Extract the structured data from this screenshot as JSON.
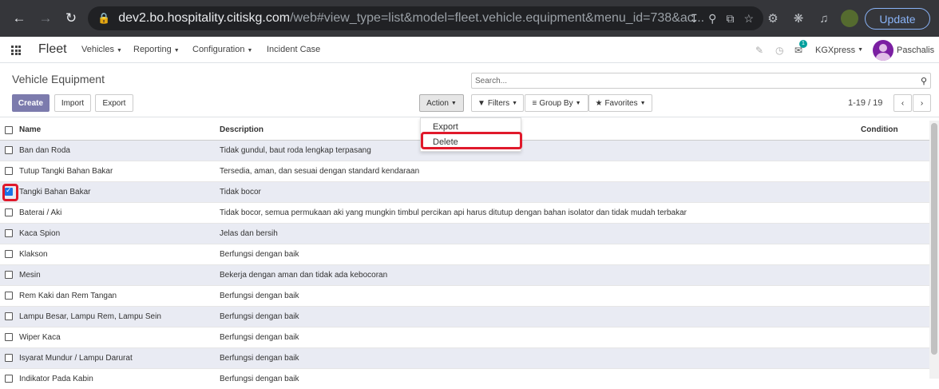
{
  "browser": {
    "url_host": "dev2.bo.hospitality.citiskg.com",
    "url_path": "/web#view_type=list&model=fleet.vehicle.equipment&menu_id=738&ac...",
    "update_label": "Update"
  },
  "nav": {
    "brand": "Fleet",
    "menus": [
      "Vehicles",
      "Reporting",
      "Configuration",
      "Incident Case"
    ],
    "notification_count": "1",
    "company": "KGXpress",
    "user": "Paschalis"
  },
  "control_panel": {
    "title": "Vehicle Equipment",
    "create_label": "Create",
    "import_label": "Import",
    "export_label": "Export",
    "action_label": "Action",
    "filters_label": "Filters",
    "group_by_label": "Group By",
    "favorites_label": "Favorites",
    "search_placeholder": "Search...",
    "pager": "1-19 / 19"
  },
  "action_menu": {
    "items": [
      "Export",
      "Delete"
    ]
  },
  "table": {
    "columns": [
      "Name",
      "Description",
      "Condition"
    ],
    "rows": [
      {
        "name": "Ban dan Roda",
        "description": "Tidak gundul, baut roda lengkap terpasang",
        "checked": false
      },
      {
        "name": "Tutup Tangki Bahan Bakar",
        "description": "Tersedia, aman, dan sesuai dengan standard kendaraan",
        "checked": false
      },
      {
        "name": "Tangki Bahan Bakar",
        "description": "Tidak bocor",
        "checked": true
      },
      {
        "name": "Baterai / Aki",
        "description": "Tidak bocor, semua permukaan aki yang mungkin timbul percikan api harus ditutup dengan bahan isolator dan tidak mudah terbakar",
        "checked": false
      },
      {
        "name": "Kaca Spion",
        "description": "Jelas dan bersih",
        "checked": false
      },
      {
        "name": "Klakson",
        "description": "Berfungsi dengan baik",
        "checked": false
      },
      {
        "name": "Mesin",
        "description": "Bekerja dengan aman dan tidak ada kebocoran",
        "checked": false
      },
      {
        "name": "Rem Kaki dan Rem Tangan",
        "description": "Berfungsi dengan baik",
        "checked": false
      },
      {
        "name": "Lampu Besar, Lampu Rem, Lampu Sein",
        "description": "Berfungsi dengan baik",
        "checked": false
      },
      {
        "name": "Wiper Kaca",
        "description": "Berfungsi dengan baik",
        "checked": false
      },
      {
        "name": "Isyarat Mundur / Lampu Darurat",
        "description": "Berfungsi dengan baik",
        "checked": false
      },
      {
        "name": "Indikator Pada Kabin",
        "description": "Berfungsi dengan baik",
        "checked": false
      }
    ]
  }
}
